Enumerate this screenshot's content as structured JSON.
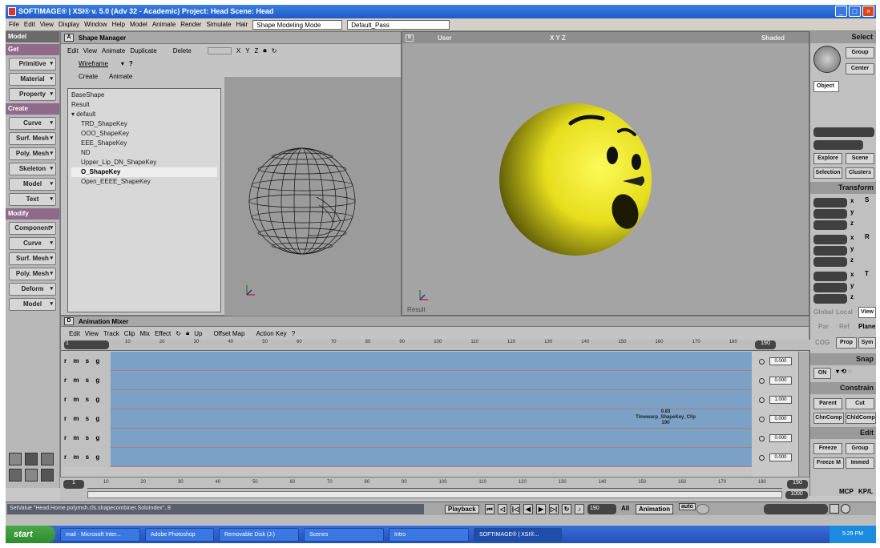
{
  "window": {
    "title": "SOFTIMAGE® | XSI® v. 5.0 (Adv 32 - Academic) Project: Head   Scene: Head"
  },
  "menubar": {
    "items": [
      "File",
      "Edit",
      "View",
      "Display",
      "Window",
      "Help",
      "Model",
      "Animate",
      "Render",
      "Simulate",
      "Hair"
    ],
    "mode": "Shape Modeling Mode",
    "pass": "Default_Pass"
  },
  "left_toolbar": {
    "title": "Model",
    "get_label": "Get",
    "get_items": [
      "Primitive",
      "Material",
      "Property"
    ],
    "create_label": "Create",
    "create_items": [
      "Curve",
      "Surf. Mesh",
      "Poly. Mesh",
      "Skeleton",
      "Model",
      "Text"
    ],
    "modify_label": "Modify",
    "modify_items": [
      "Component",
      "Curve",
      "Surf. Mesh",
      "Poly. Mesh",
      "Deform",
      "Model"
    ]
  },
  "shape_manager": {
    "title": "Shape Manager",
    "menu": [
      "Edit",
      "View",
      "Animate",
      "Duplicate",
      "Delete"
    ],
    "axes": [
      "X",
      "Y",
      "Z"
    ],
    "display_mode": "Wireframe",
    "help": "?",
    "tabs": [
      "Create",
      "Animate"
    ],
    "tree": [
      "BaseShape",
      "Result",
      "default",
      "TRD_ShapeKey",
      "OOO_ShapeKey",
      "EEE_ShapeKey",
      "ND",
      "Upper_Lip_DN_ShapeKey",
      "O_ShapeKey",
      "Open_EEEE_ShapeKey"
    ],
    "selected": "O_ShapeKey"
  },
  "viewport_main": {
    "camera": "User",
    "axes": "X Y Z",
    "shading": "Shaded",
    "label": "Result",
    "face_color": "#e8e020"
  },
  "animation_mixer": {
    "title": "Animation Mixer",
    "menu": [
      "Edit",
      "View",
      "Track",
      "Clip",
      "Mix",
      "Effect",
      "Up",
      "Offset Map",
      "Action Key",
      "?"
    ],
    "range_start": "1",
    "range_end": "190",
    "ruler": [
      "10",
      "20",
      "30",
      "40",
      "50",
      "60",
      "70",
      "80",
      "90",
      "100",
      "110",
      "120",
      "130",
      "140",
      "150",
      "160",
      "170",
      "180"
    ],
    "track_controls": "r m s g",
    "weights": [
      "0.000",
      "0.000",
      "1.000",
      "0.000",
      "0.000",
      "0.000"
    ],
    "clip_value": "0.83",
    "clip_name": "Timewarp_ShapeKey_Clip",
    "clip_frame": "190"
  },
  "right_panel": {
    "select_title": "Select",
    "group_label": "Group",
    "center_label": "Center",
    "object_label": "Object",
    "explore_label": "Explore",
    "scene_label": "Scene",
    "selection_label": "Selection",
    "clusters_label": "Clusters",
    "transform_title": "Transform",
    "axes": [
      "x",
      "y",
      "z"
    ],
    "global_label": "Global",
    "local_label": "Local",
    "view_label": "View",
    "par_label": "Par",
    "ref_label": "Ref",
    "plane_label": "Plane",
    "cog_label": "COG",
    "prop_label": "Prop",
    "sym_label": "Sym",
    "snap_title": "Snap",
    "snap_on": "ON",
    "constrain_title": "Constrain",
    "parent_label": "Parent",
    "cut_label": "Cut",
    "chncomp_label": "ChnComp",
    "chldcomp_label": "ChldComp",
    "edit_title": "Edit",
    "freeze_label": "Freeze",
    "group2_label": "Group",
    "freezem_label": "Freeze M",
    "immed_label": "Immed",
    "mcp_label": "MCP",
    "kpl_label": "KP/L"
  },
  "timeline": {
    "start": "1",
    "end": "190",
    "max": "1000",
    "ruler": [
      "10",
      "20",
      "30",
      "40",
      "50",
      "60",
      "70",
      "80",
      "90",
      "100",
      "110",
      "120",
      "130",
      "140",
      "150",
      "160",
      "170",
      "180"
    ]
  },
  "statusbar": {
    "command": "SetValue \"Head.Home.polymsh.cls.shapecombiner.SoloIndex\", 8",
    "playback_label": "Playback",
    "frame_value": "190",
    "all_label": "All",
    "animation_label": "Animation",
    "auto_label": "auto"
  },
  "taskbar": {
    "start_label": "start",
    "tasks": [
      "mail - Microsoft Inter...",
      "Adobe Photoshop",
      "Removable Disk (J:)",
      "Scenes",
      "Intro",
      "SOFTIMAGE® | XSI®..."
    ],
    "active_task": 5,
    "clock": "5:29 PM"
  }
}
